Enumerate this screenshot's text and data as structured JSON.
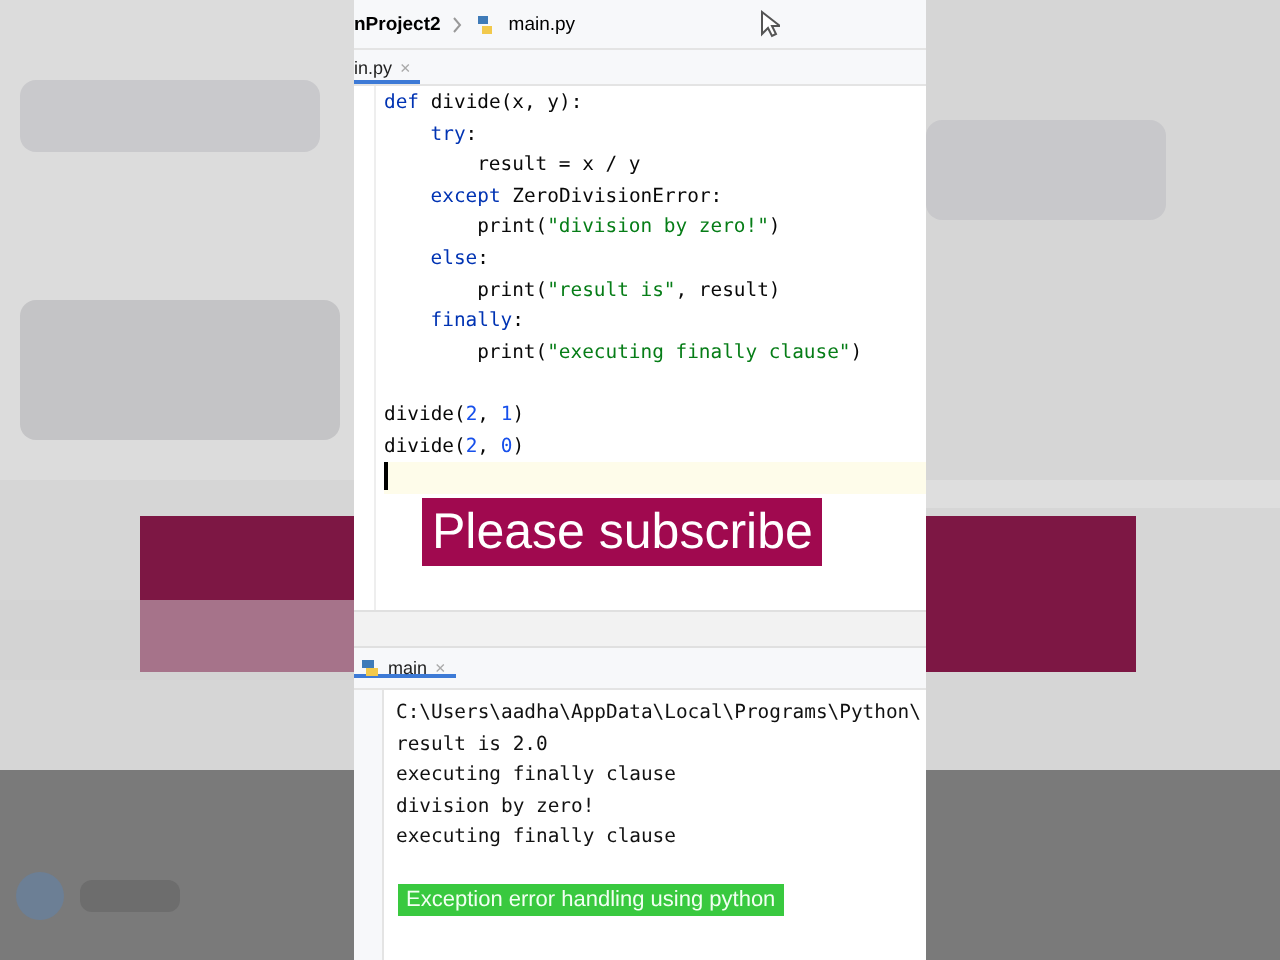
{
  "breadcrumb": {
    "project": "nProject2",
    "file": "main.py"
  },
  "editor_tab": {
    "label": "in.py",
    "close": "×",
    "selected": true
  },
  "code": [
    {
      "tokens": [
        {
          "kind": "keyword",
          "text": "def "
        },
        {
          "kind": "plain",
          "text": "divide(x, y):"
        }
      ],
      "children": [
        {
          "tokens": [
            {
              "kind": "keyword",
              "text": "try"
            },
            {
              "kind": "plain",
              "text": ":"
            }
          ],
          "children": [
            {
              "tokens": [
                {
                  "kind": "plain",
                  "text": "result = x / y"
                }
              ]
            }
          ]
        },
        {
          "tokens": [
            {
              "kind": "keyword",
              "text": "except "
            },
            {
              "kind": "plain",
              "text": "ZeroDivisionError:"
            }
          ],
          "children": [
            {
              "tokens": [
                {
                  "kind": "plain",
                  "text": "print("
                },
                {
                  "kind": "string",
                  "text": "\"division by zero!\""
                },
                {
                  "kind": "plain",
                  "text": ")"
                }
              ]
            }
          ]
        },
        {
          "tokens": [
            {
              "kind": "keyword",
              "text": "else"
            },
            {
              "kind": "plain",
              "text": ":"
            }
          ],
          "children": [
            {
              "tokens": [
                {
                  "kind": "plain",
                  "text": "print("
                },
                {
                  "kind": "string",
                  "text": "\"result is\""
                },
                {
                  "kind": "plain",
                  "text": ", result)"
                }
              ]
            }
          ]
        },
        {
          "tokens": [
            {
              "kind": "keyword",
              "text": "finally"
            },
            {
              "kind": "plain",
              "text": ":"
            }
          ],
          "children": [
            {
              "tokens": [
                {
                  "kind": "plain",
                  "text": "print("
                },
                {
                  "kind": "string",
                  "text": "\"executing finally clause\""
                },
                {
                  "kind": "plain",
                  "text": ")"
                }
              ]
            }
          ]
        }
      ]
    },
    {
      "tokens": [
        {
          "kind": "plain",
          "text": "divide("
        },
        {
          "kind": "number",
          "text": "2"
        },
        {
          "kind": "plain",
          "text": ", "
        },
        {
          "kind": "number",
          "text": "1"
        },
        {
          "kind": "plain",
          "text": ")"
        }
      ]
    },
    {
      "tokens": [
        {
          "kind": "plain",
          "text": "divide("
        },
        {
          "kind": "number",
          "text": "2"
        },
        {
          "kind": "plain",
          "text": ", "
        },
        {
          "kind": "number",
          "text": "0"
        },
        {
          "kind": "plain",
          "text": ")"
        }
      ]
    }
  ],
  "run_tab": {
    "label": "main",
    "close": "×",
    "selected": true
  },
  "console": [
    "C:\\Users\\aadha\\AppData\\Local\\Programs\\Python\\",
    "result is 2.0",
    "executing finally clause",
    "division by zero!",
    "executing finally clause"
  ],
  "overlays": [
    {
      "kind": "banner",
      "text": "Please subscribe"
    },
    {
      "kind": "caption",
      "text": "Exception error handling using python"
    }
  ]
}
